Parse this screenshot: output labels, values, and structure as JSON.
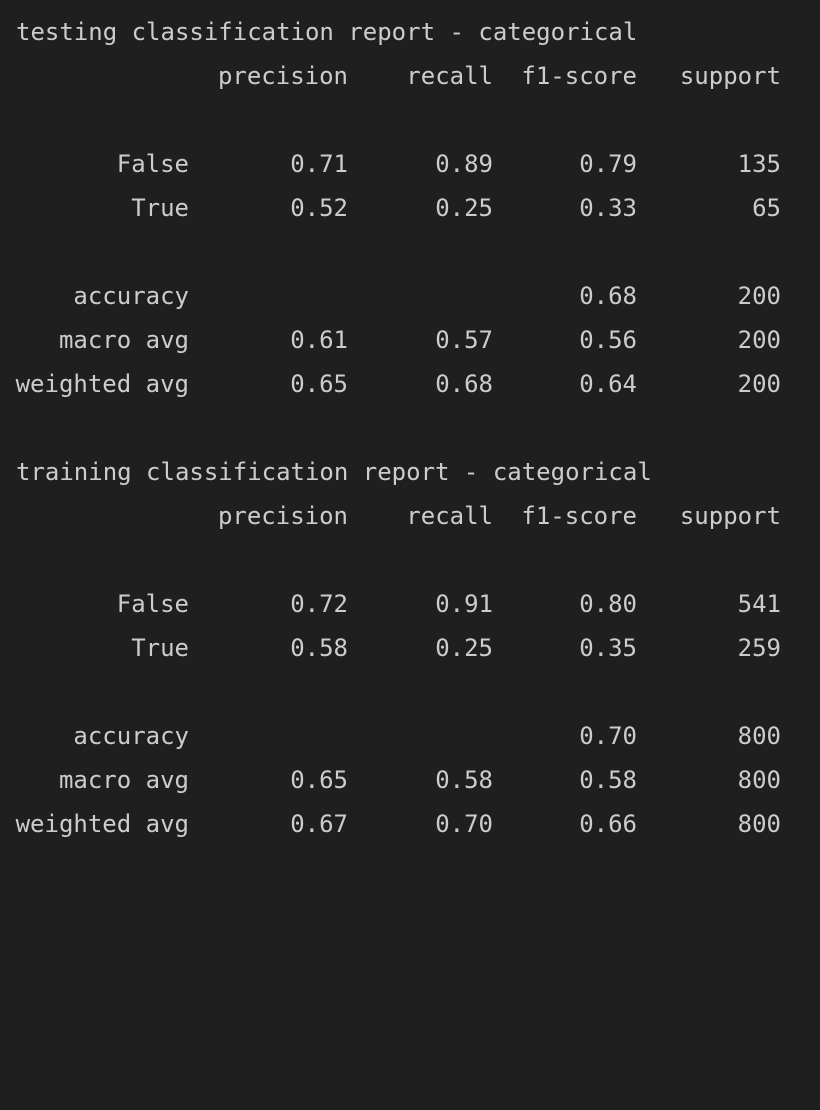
{
  "colors": {
    "background": "#1f1f1f",
    "text": "#cccccc"
  },
  "reports": [
    {
      "title": "testing classification report - categorical",
      "headers": {
        "precision": "precision",
        "recall": "recall",
        "f1": "f1-score",
        "support": "support"
      },
      "class_rows": [
        {
          "label": "False",
          "precision": "0.71",
          "recall": "0.89",
          "f1": "0.79",
          "support": "135"
        },
        {
          "label": "True",
          "precision": "0.52",
          "recall": "0.25",
          "f1": "0.33",
          "support": "65"
        }
      ],
      "summary_rows": [
        {
          "label": "accuracy",
          "precision": "",
          "recall": "",
          "f1": "0.68",
          "support": "200"
        },
        {
          "label": "macro avg",
          "precision": "0.61",
          "recall": "0.57",
          "f1": "0.56",
          "support": "200"
        },
        {
          "label": "weighted avg",
          "precision": "0.65",
          "recall": "0.68",
          "f1": "0.64",
          "support": "200"
        }
      ]
    },
    {
      "title": "training classification report - categorical",
      "headers": {
        "precision": "precision",
        "recall": "recall",
        "f1": "f1-score",
        "support": "support"
      },
      "class_rows": [
        {
          "label": "False",
          "precision": "0.72",
          "recall": "0.91",
          "f1": "0.80",
          "support": "541"
        },
        {
          "label": "True",
          "precision": "0.58",
          "recall": "0.25",
          "f1": "0.35",
          "support": "259"
        }
      ],
      "summary_rows": [
        {
          "label": "accuracy",
          "precision": "",
          "recall": "",
          "f1": "0.70",
          "support": "800"
        },
        {
          "label": "macro avg",
          "precision": "0.65",
          "recall": "0.58",
          "f1": "0.58",
          "support": "800"
        },
        {
          "label": "weighted avg",
          "precision": "0.67",
          "recall": "0.70",
          "f1": "0.66",
          "support": "800"
        }
      ]
    }
  ]
}
